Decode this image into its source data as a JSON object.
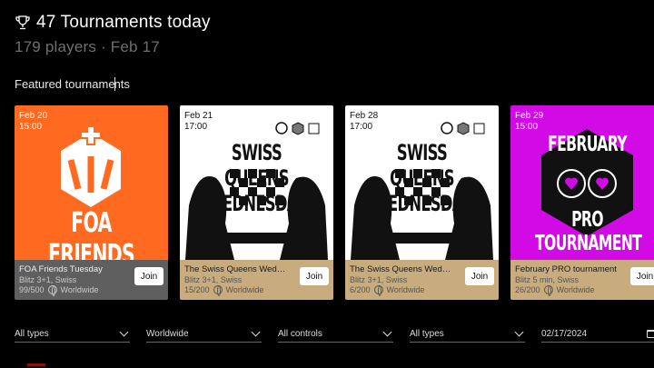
{
  "header": {
    "title": "47 Tournaments today",
    "subtitle": "179 players · Feb 17"
  },
  "section": {
    "title_before_caret": "Featured tourname",
    "title_after_caret": "nts"
  },
  "cards": [
    {
      "date": "Feb 20",
      "time": "15:00",
      "title": "FOA Friends Tuesday",
      "meta": "Blitz 3+1, Swiss",
      "players": "99/500",
      "region": "Worldwide",
      "join": "Join",
      "art_text": "FOA FRIENDS",
      "art_color": "#ff6a20"
    },
    {
      "date": "Feb 21",
      "time": "17:00",
      "title": "The Swiss Queens Wednesday",
      "meta": "Blitz 3+1, Swiss",
      "players": "15/200",
      "region": "Worldwide",
      "join": "Join",
      "art_text": "SWISS QUEENS WEDNESDAY"
    },
    {
      "date": "Feb 28",
      "time": "17:00",
      "title": "The Swiss Queens Wednesday",
      "meta": "Blitz 3+1, Swiss",
      "players": "6/200",
      "region": "Worldwide",
      "join": "Join",
      "art_text": "SWISS QUEENS WEDNESDAY"
    },
    {
      "date": "Feb 29",
      "time": "15:00",
      "title": "February PRO tournament",
      "meta": "Blitz 5 min, Swiss",
      "players": "26/200",
      "region": "Worldwide",
      "join": "Join",
      "art_text_top": "FEBRUARY",
      "art_text_bottom": "PRO TOURNAMENT",
      "art_color": "#d10ae6"
    }
  ],
  "filters": {
    "type1": "All types",
    "region": "Worldwide",
    "controls": "All controls",
    "type2": "All types",
    "date": "02/17/2024"
  },
  "colors": {
    "accent_orange": "#ff6a20",
    "accent_magenta": "#d10ae6",
    "info_tan": "#c8ac7d"
  }
}
